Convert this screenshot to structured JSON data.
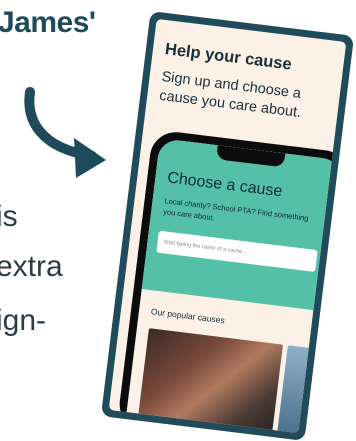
{
  "background": {
    "name": "James'",
    "lines": [
      "is",
      "extra",
      "ign-"
    ]
  },
  "card": {
    "title": "Help your cause",
    "subtitle": "Sign up and choose a cause you care about."
  },
  "phone_screen": {
    "heading": "Choose a cause",
    "description": "Local charity? School PTA? Find something you care about.",
    "search_placeholder": "Start typing the name of a cause...",
    "section_title": "Our popular causes"
  },
  "colors": {
    "card_border": "#1f4b5a",
    "card_bg": "#fbf1e6",
    "teal": "#54c0a8",
    "text_dark": "#17303b"
  }
}
